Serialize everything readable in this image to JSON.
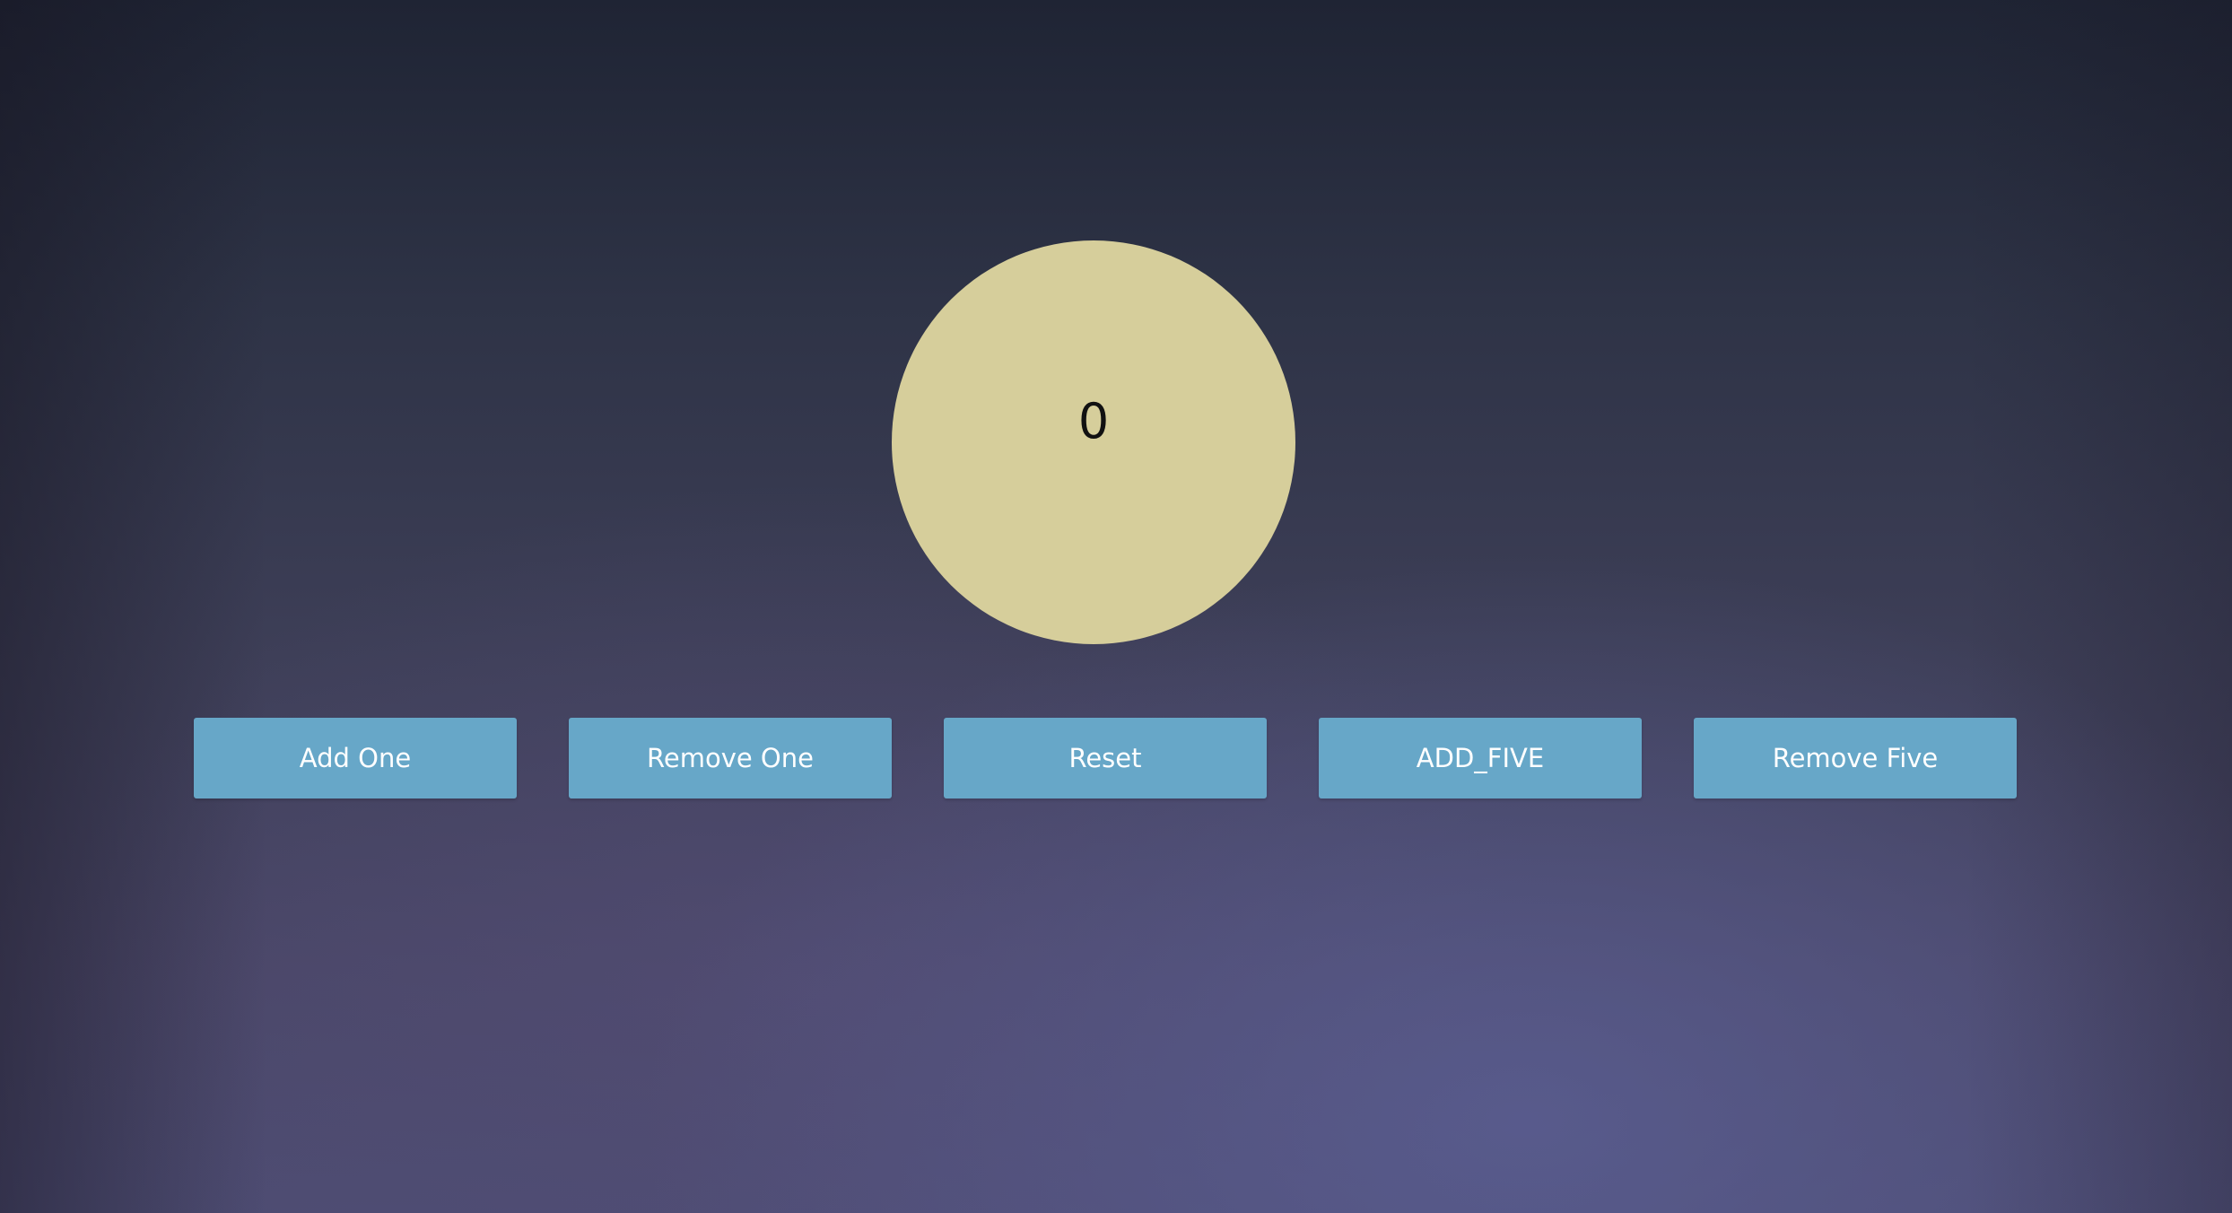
{
  "counter": {
    "value": "0"
  },
  "buttons": {
    "add_one": "Add One",
    "remove_one": "Remove One",
    "reset": "Reset",
    "add_five": "ADD_FIVE",
    "remove_five": "Remove Five"
  },
  "colors": {
    "circle": "#d6ce9b",
    "button": "#67a7c8",
    "button_text": "#ffffff",
    "counter_text": "#111111"
  }
}
